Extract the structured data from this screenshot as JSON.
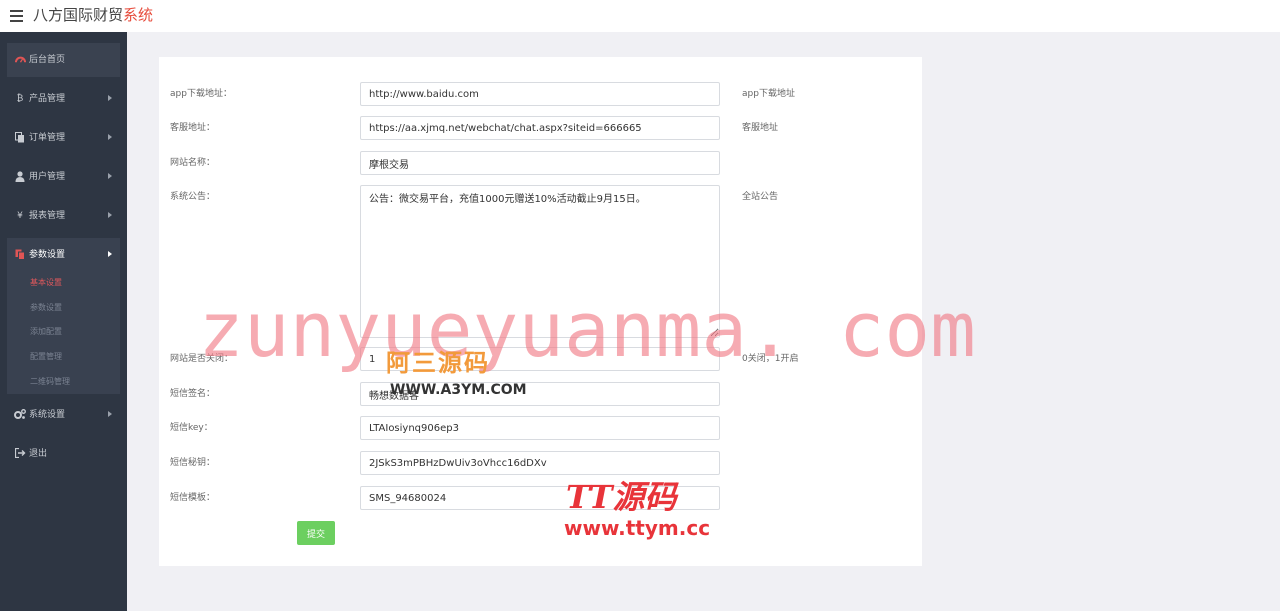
{
  "header": {
    "brand_main": "八方国际财贸",
    "brand_accent": "系统",
    "accent_color": "#e74c3c"
  },
  "sidebar": {
    "items": [
      {
        "label": "后台首页",
        "icon": "dashboard-icon"
      },
      {
        "label": "产品管理",
        "icon": "bitcoin-icon",
        "icon_glyph": "₿"
      },
      {
        "label": "订单管理",
        "icon": "copy-icon"
      },
      {
        "label": "用户管理",
        "icon": "user-icon"
      },
      {
        "label": "报表管理",
        "icon": "yen-icon",
        "icon_glyph": "¥"
      },
      {
        "label": "参数设置",
        "icon": "settings-file-icon"
      },
      {
        "label": "系统设置",
        "icon": "gears-icon"
      },
      {
        "label": "退出",
        "icon": "sign-out-icon"
      }
    ],
    "submenu": [
      {
        "label": "基本设置",
        "active": true
      },
      {
        "label": "参数设置"
      },
      {
        "label": "添加配置"
      },
      {
        "label": "配置管理"
      },
      {
        "label": "二维码管理"
      }
    ]
  },
  "form": {
    "rows": [
      {
        "label": "app下载地址：",
        "value": "http://www.baidu.com",
        "hint": "app下载地址"
      },
      {
        "label": "客服地址：",
        "value": "https://aa.xjmq.net/webchat/chat.aspx?siteid=666665",
        "hint": "客服地址"
      },
      {
        "label": "网站名称：",
        "value": "摩根交易",
        "hint": ""
      },
      {
        "label": "系统公告：",
        "value": "公告：微交易平台，充值1000元赠送10%活动截止9月15日。",
        "hint": "全站公告"
      },
      {
        "label": "网站是否关闭：",
        "value": "1",
        "hint": "0关闭，1开启"
      },
      {
        "label": "短信签名：",
        "value": "畅想数据客",
        "hint": ""
      },
      {
        "label": "短信key：",
        "value": "LTAIosiynq906ep3",
        "hint": ""
      },
      {
        "label": "短信秘钥：",
        "value": "2JSkS3mPBHzDwUiv3oVhcc16dDXv",
        "hint": ""
      },
      {
        "label": "短信模板：",
        "value": "SMS_94680024",
        "hint": ""
      }
    ],
    "submit_label": "提交",
    "submit_color": "#6ccf60"
  },
  "watermarks": {
    "main": "zunyueyuanma. com",
    "a3_title": "阿三源码",
    "a3_url": "WWW.A3YM.COM",
    "tt_title": "TT源码",
    "tt_url": "www.ttym.cc"
  }
}
